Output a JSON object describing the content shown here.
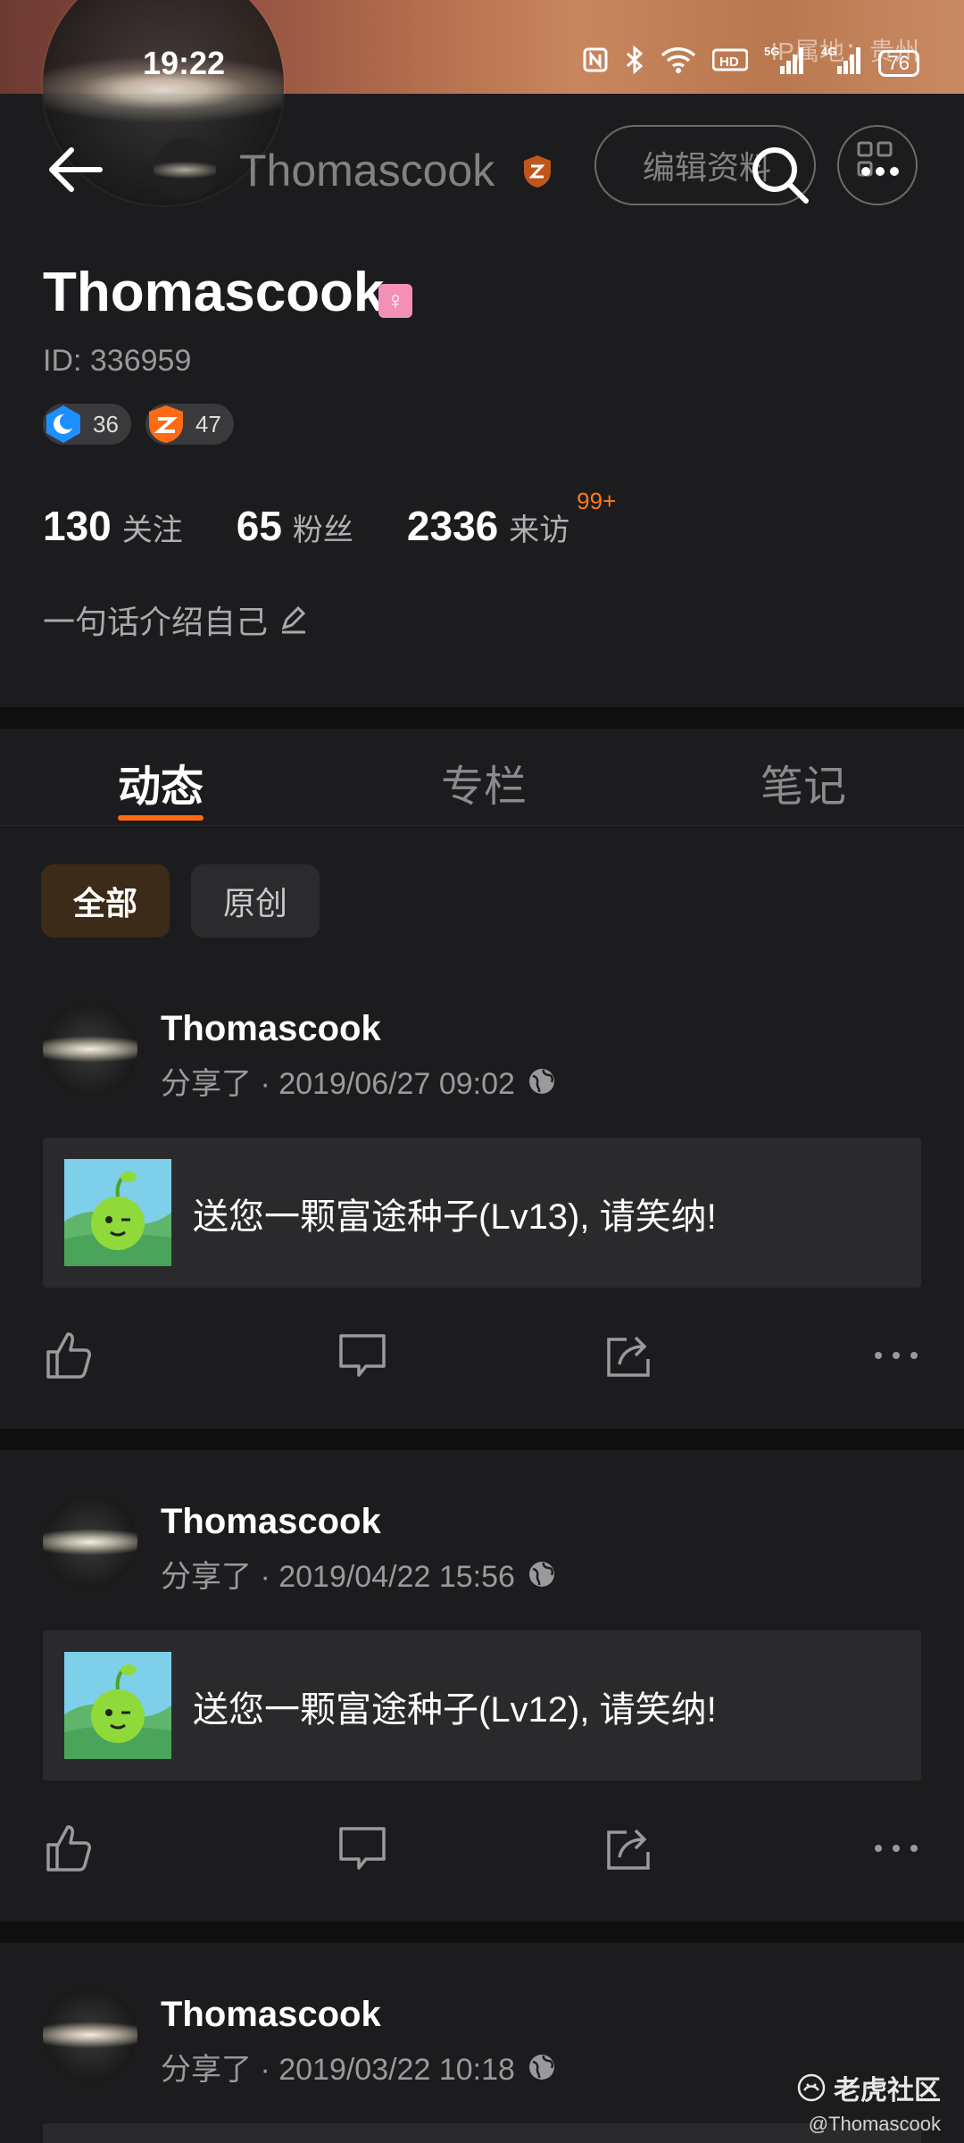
{
  "status_bar": {
    "time": "19:22",
    "battery": "76",
    "ip_location": "IP属地：贵州",
    "icons": [
      "nfc-icon",
      "bluetooth-icon",
      "wifi-icon",
      "hd-icon",
      "signal-5g-icon",
      "signal-4g-icon",
      "battery-icon"
    ]
  },
  "nav": {
    "name": "Thomascook",
    "edit_label": "编辑资料"
  },
  "profile": {
    "username": "Thomascook",
    "gender_symbol": "♀",
    "id_text": "ID: 336959",
    "badges": [
      {
        "icon": "moon-badge-icon",
        "count": "36",
        "color": "#1e8fff"
      },
      {
        "icon": "shield-badge-icon",
        "count": "47",
        "color": "#ff6a13"
      }
    ],
    "stats": [
      {
        "num": "130",
        "label": "关注"
      },
      {
        "num": "65",
        "label": "粉丝"
      },
      {
        "num": "2336",
        "label": "来访",
        "sup": "99+"
      }
    ],
    "bio_placeholder": "一句话介绍自己"
  },
  "tabs": [
    {
      "label": "动态",
      "active": true
    },
    {
      "label": "专栏",
      "active": false
    },
    {
      "label": "笔记",
      "active": false
    }
  ],
  "filters": [
    {
      "label": "全部",
      "active": true
    },
    {
      "label": "原创",
      "active": false
    }
  ],
  "posts": [
    {
      "name": "Thomascook",
      "meta": "分享了 · 2019/06/27 09:02",
      "card_text": "送您一颗富途种子(Lv13), 请笑纳!"
    },
    {
      "name": "Thomascook",
      "meta": "分享了 · 2019/04/22 15:56",
      "card_text": "送您一颗富途种子(Lv12), 请笑纳!"
    },
    {
      "name": "Thomascook",
      "meta": "分享了 · 2019/03/22 10:18",
      "card_text": ""
    }
  ],
  "watermark": {
    "brand": "老虎社区",
    "handle": "@Thomascook"
  },
  "colors": {
    "accent": "#ff6a13",
    "background": "#1c1c1e",
    "card": "#2a2a2c"
  }
}
